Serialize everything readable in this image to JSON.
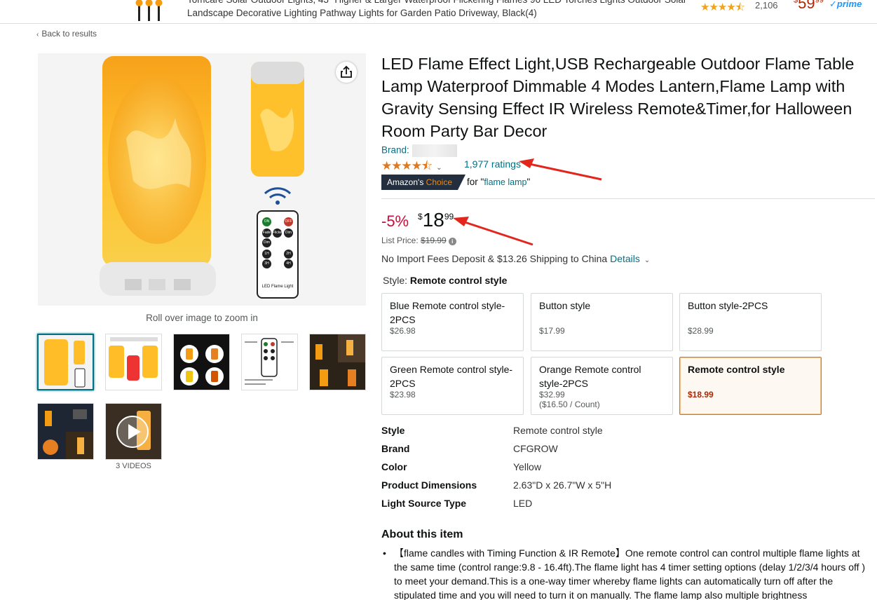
{
  "top_product": {
    "title": "Tomcare Solar Outdoor Lights, 43\" Higher & Larger Waterproof Flickering Flames 96 LED Torches Lights Outdoor Solar Landscape Decorative Lighting Pathway Lights for Garden Patio Driveway, Black(4)",
    "stars": "★★★★⯪",
    "rating_count": "2,106",
    "price_symbol": "$",
    "price_whole": "59",
    "price_fraction": "99",
    "prime_label": "✓prime"
  },
  "nav": {
    "back_label": "Back to results",
    "back_icon": "chevron-left-icon"
  },
  "gallery": {
    "remote_label": "LED Flame Light",
    "remote_buttons": [
      "ON",
      "OFF",
      "Fade",
      "Flicker",
      "Dim",
      "Dim",
      "1H",
      "2H",
      "3H",
      "4H"
    ],
    "roll_over_text": "Roll over image to zoom in",
    "videos_label": "3 VIDEOS"
  },
  "product": {
    "title": "LED Flame Effect Light,USB Rechargeable Outdoor Flame Table Lamp Waterproof Dimmable 4 Modes Lantern,Flame Lamp with Gravity Sensing Effect IR Wireless Remote&Timer,for Halloween Room Party Bar Decor",
    "brand_label": "Brand:",
    "stars": "★★★★⯪",
    "rating_value": 4.4,
    "ratings_link": "1,977 ratings",
    "choice_prefix": "Amazon's",
    "choice_suffix": "Choice",
    "choice_for": "for \"",
    "choice_keyword": "flame lamp",
    "choice_close": "\"",
    "discount": "-5%",
    "price_symbol": "$",
    "price_whole": "18",
    "price_fraction": "99",
    "list_price_label": "List Price:",
    "list_price": "$19.99",
    "shipping_text": "No Import Fees Deposit & $13.26 Shipping to China",
    "shipping_details": "Details",
    "style_label": "Style:",
    "style_value": "Remote control style"
  },
  "style_options": [
    {
      "name": "Blue Remote control style-2PCS",
      "price": "$26.98",
      "unit": ""
    },
    {
      "name": "Button style",
      "price": "$17.99",
      "unit": ""
    },
    {
      "name": "Button style-2PCS",
      "price": "$28.99",
      "unit": ""
    },
    {
      "name": "Green Remote control style-2PCS",
      "price": "$23.98",
      "unit": ""
    },
    {
      "name": "Orange Remote control style-2PCS",
      "price": "$32.99",
      "unit": "($16.50 / Count)"
    },
    {
      "name": "Remote control style",
      "price": "$18.99",
      "unit": ""
    }
  ],
  "specs": [
    {
      "key": "Style",
      "value": "Remote control style"
    },
    {
      "key": "Brand",
      "value": "CFGROW"
    },
    {
      "key": "Color",
      "value": "Yellow"
    },
    {
      "key": "Product Dimensions",
      "value": "2.63\"D x 26.7\"W x 5\"H"
    },
    {
      "key": "Light Source Type",
      "value": "LED"
    }
  ],
  "about": {
    "heading": "About this item",
    "bullets": [
      "【flame candles with Timing Function & IR Remote】One remote control can control multiple flame lights at the same time (control range:9.8 - 16.4ft).The flame light has 4 timer setting options (delay 1/2/3/4 hours off ) to meet your demand.This is a one-way timer whereby flame lights can automatically turn off after the stipulated time and you will need to turn it on manually. The flame lamp also multiple brightness"
    ]
  },
  "colors": {
    "link": "#007185",
    "discount": "#cc0c39",
    "star": "#de7921",
    "selected_border": "#e77600",
    "annotation_arrow": "#e3261c"
  }
}
